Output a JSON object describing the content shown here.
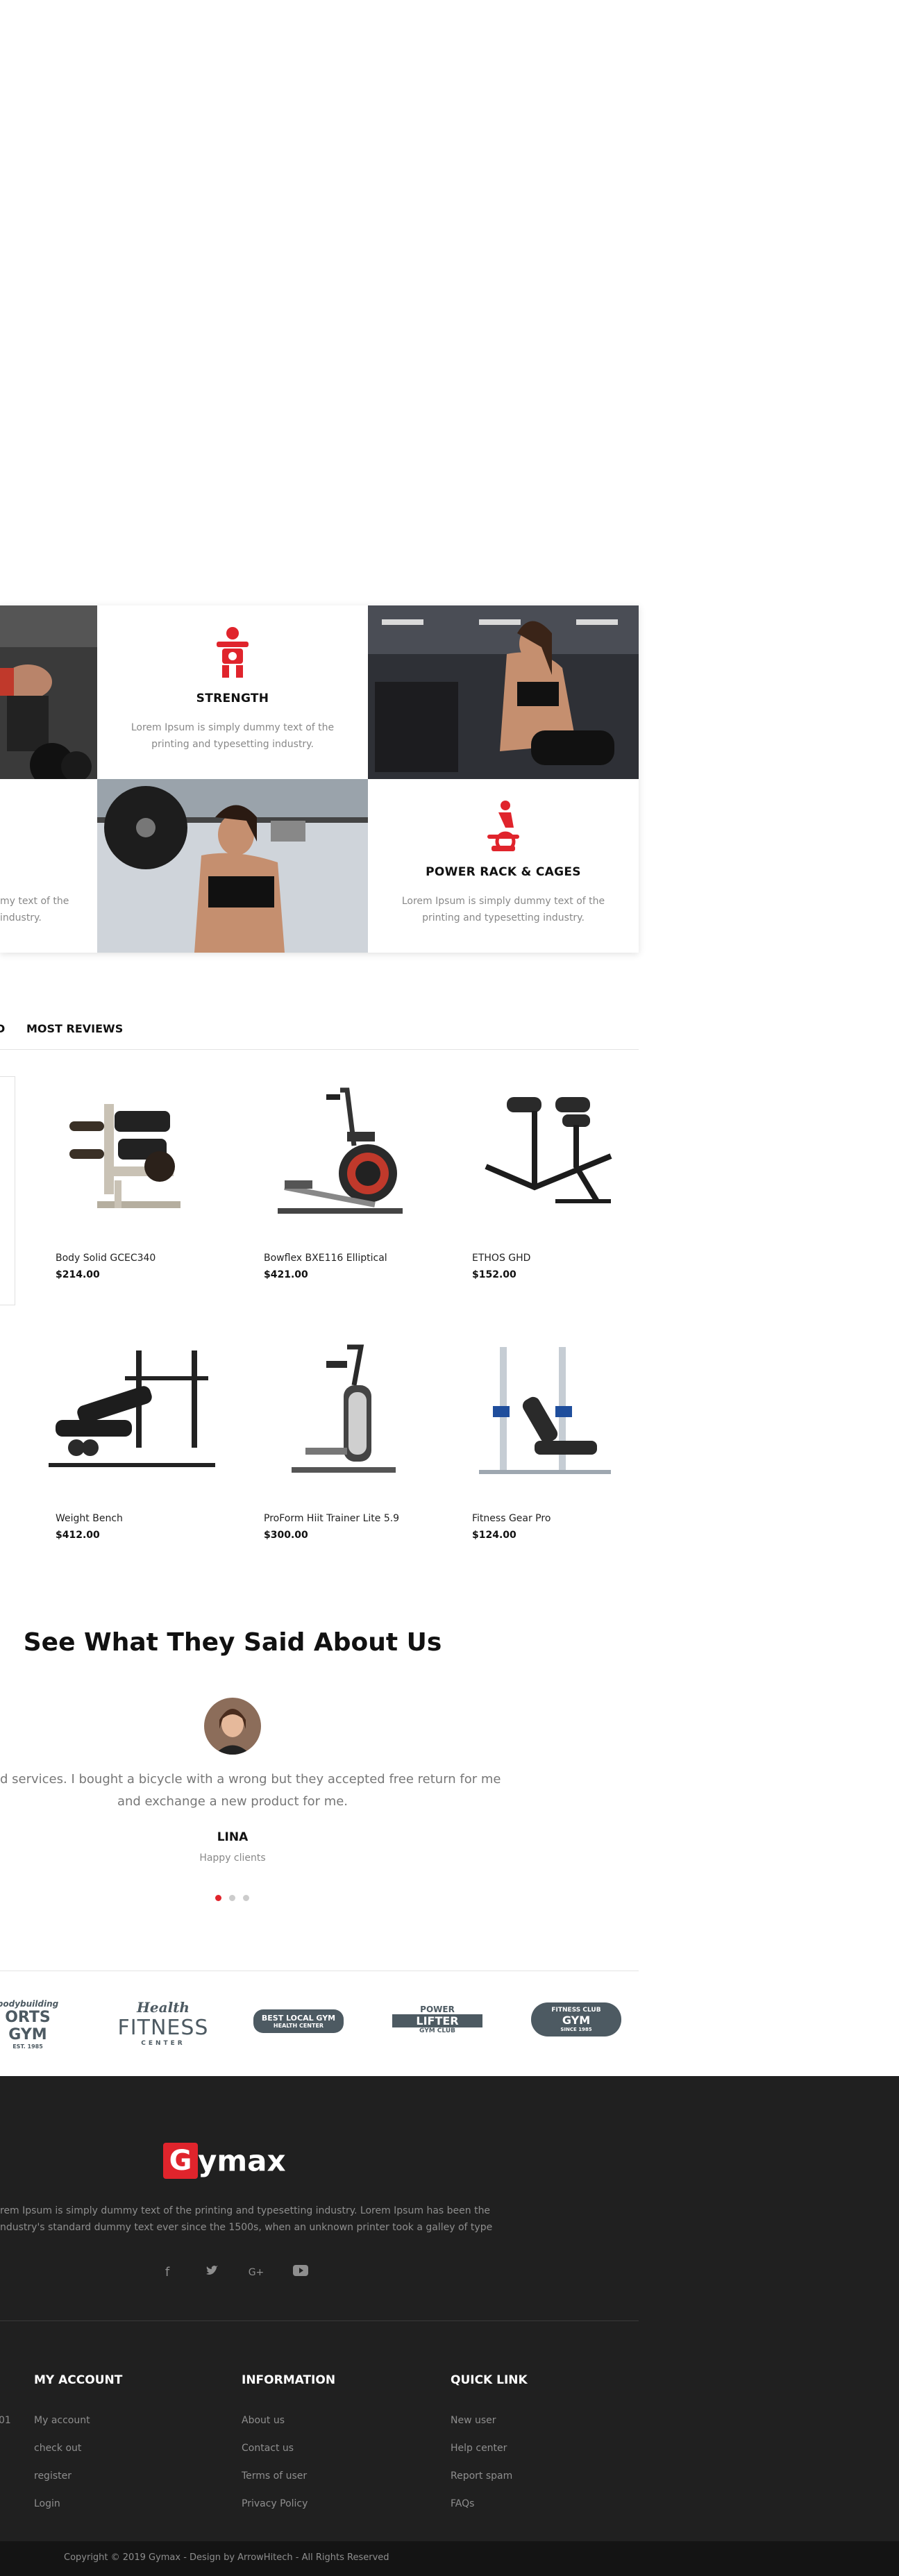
{
  "features": {
    "strength": {
      "title": "STRENGTH",
      "desc_line1": "Lorem Ipsum is simply dummy text of the",
      "desc_line2": "printing and typesetting industry."
    },
    "power_rack": {
      "title": "POWER RACK & CAGES",
      "desc_line1": "Lorem Ipsum is simply dummy text of the",
      "desc_line2": "printing and typesetting industry."
    },
    "left_partial": {
      "line1": "my text of the",
      "line2": "industry."
    }
  },
  "tabs": {
    "partial": "D",
    "most_reviews": "MOST REVIEWS"
  },
  "products": [
    {
      "name": "Body Solid GCEC340",
      "price": "$214.00"
    },
    {
      "name": "Bowflex BXE116 Elliptical",
      "price": "$421.00"
    },
    {
      "name": "ETHOS GHD",
      "price": "$152.00"
    },
    {
      "name": "Weight Bench",
      "price": "$412.00"
    },
    {
      "name": "ProForm Hiit Trainer Lite 5.9",
      "price": "$300.00"
    },
    {
      "name": "Fitness Gear Pro",
      "price": "$124.00"
    }
  ],
  "testimonial": {
    "heading": "See What They Said About Us",
    "quote_line1": "d services. I bought a bicycle with a wrong but they accepted free return for me",
    "quote_line2": "and exchange a new product for me.",
    "name": "LINA",
    "role": "Happy clients"
  },
  "brands": [
    {
      "line1": "bodybuilding",
      "line2": "ORTS GYM",
      "line3": "EST. 1985"
    },
    {
      "line1": "Health",
      "line2": "FITNESS",
      "line3": "CENTER"
    },
    {
      "line1": "BEST LOCAL GYM",
      "line2": "HEALTH CENTER",
      "line3": ""
    },
    {
      "line1": "POWER",
      "line2": "LIFTER",
      "line3": "GYM CLUB"
    },
    {
      "line1": "FITNESS CLUB",
      "line2": "GYM",
      "line3": "SINCE 1985"
    }
  ],
  "footer": {
    "logo_letter": "G",
    "logo_rest": "ymax",
    "about_line1": "rem Ipsum is simply dummy text of the printing and typesetting industry. Lorem Ipsum has been the",
    "about_line2": "ndustry's standard dummy text ever since the 1500s, when an unknown printer took a galley of type",
    "social_icons": [
      "facebook-icon",
      "twitter-icon",
      "google-plus-icon",
      "youtube-icon"
    ],
    "partial_text": "01",
    "columns": [
      {
        "title": "MY ACCOUNT",
        "links": [
          "My account",
          "check out",
          "register",
          "Login"
        ]
      },
      {
        "title": "INFORMATION",
        "links": [
          "About us",
          "Contact us",
          "Terms of user",
          "Privacy Policy"
        ]
      },
      {
        "title": "QUICK LINK",
        "links": [
          "New user",
          "Help center",
          "Report spam",
          "FAQs"
        ]
      }
    ],
    "copyright": "Copyright © 2019 Gymax - Design by ArrowHitech - All Rights Reserved"
  },
  "colors": {
    "accent": "#e0242c",
    "footer_bg": "#202020",
    "copy_bg": "#141414"
  }
}
